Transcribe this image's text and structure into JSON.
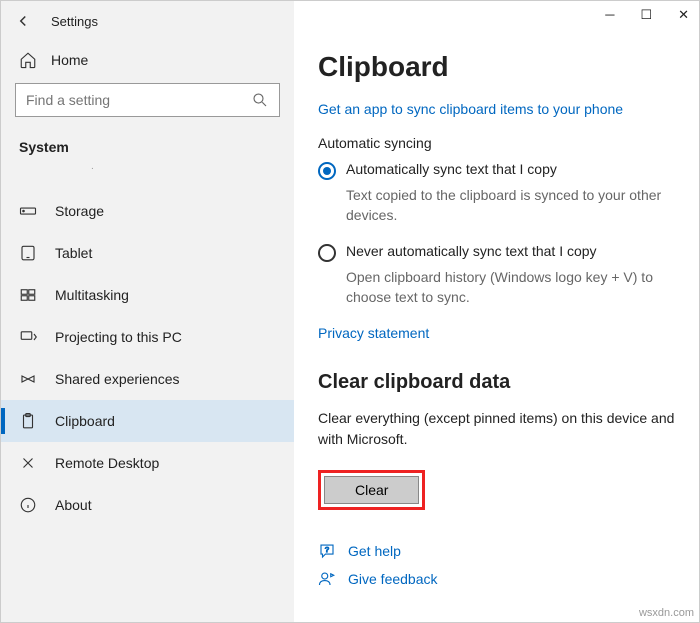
{
  "window": {
    "title": "Settings"
  },
  "sidebar": {
    "home": "Home",
    "search_placeholder": "Find a setting",
    "section": "System",
    "items": [
      {
        "label": "Storage"
      },
      {
        "label": "Tablet"
      },
      {
        "label": "Multitasking"
      },
      {
        "label": "Projecting to this PC"
      },
      {
        "label": "Shared experiences"
      },
      {
        "label": "Clipboard"
      },
      {
        "label": "Remote Desktop"
      },
      {
        "label": "About"
      }
    ]
  },
  "main": {
    "heading": "Clipboard",
    "sync_link": "Get an app to sync clipboard items to your phone",
    "auto_heading": "Automatic syncing",
    "radio1_label": "Automatically sync text that I copy",
    "radio1_hint": "Text copied to the clipboard is synced to your other devices.",
    "radio2_label": "Never automatically sync text that I copy",
    "radio2_hint": "Open clipboard history (Windows logo key + V) to choose text to sync.",
    "privacy": "Privacy statement",
    "clear_heading": "Clear clipboard data",
    "clear_desc": "Clear everything (except pinned items) on this device and with Microsoft.",
    "clear_button": "Clear",
    "help": "Get help",
    "feedback": "Give feedback"
  },
  "credit": "wsxdn.com"
}
